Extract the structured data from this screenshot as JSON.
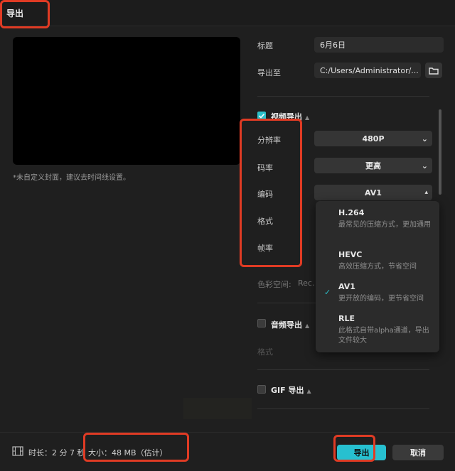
{
  "window": {
    "title": "导出"
  },
  "preview": {
    "cover_note": "*未自定义封面，建议去时间线设置。"
  },
  "form": {
    "title_label": "标题",
    "title_value": "6月6日",
    "export_to_label": "导出至",
    "export_to_value": "C:/Users/Administrator/..."
  },
  "video": {
    "section_label": "视频导出",
    "resolution_label": "分辨率",
    "resolution_value": "480P",
    "bitrate_label": "码率",
    "bitrate_value": "更高",
    "codec_label": "编码",
    "codec_value": "AV1",
    "format_label": "格式",
    "framerate_label": "帧率",
    "colorspace_label": "色彩空间:",
    "colorspace_value": "Rec."
  },
  "codec_menu": {
    "options": [
      {
        "name": "H.264",
        "desc": "最常见的压缩方式，更加通用"
      },
      {
        "name": "HEVC",
        "desc": "高效压缩方式，节省空间"
      },
      {
        "name": "AV1",
        "desc": "更开放的编码，更节省空间",
        "selected": true
      },
      {
        "name": "RLE",
        "desc": "此格式自带alpha通道，导出文件较大"
      }
    ]
  },
  "audio": {
    "section_label": "音频导出",
    "format_label": "格式"
  },
  "gif": {
    "section_label": "GIF 导出"
  },
  "footer": {
    "duration": "时长：2 分 7 秒",
    "size": "大小：48 MB（估计）",
    "export_label": "导出",
    "cancel_label": "取消"
  },
  "colors": {
    "accent": "#27c0d0",
    "highlight": "#e03b24",
    "background": "#1f1f1f"
  }
}
